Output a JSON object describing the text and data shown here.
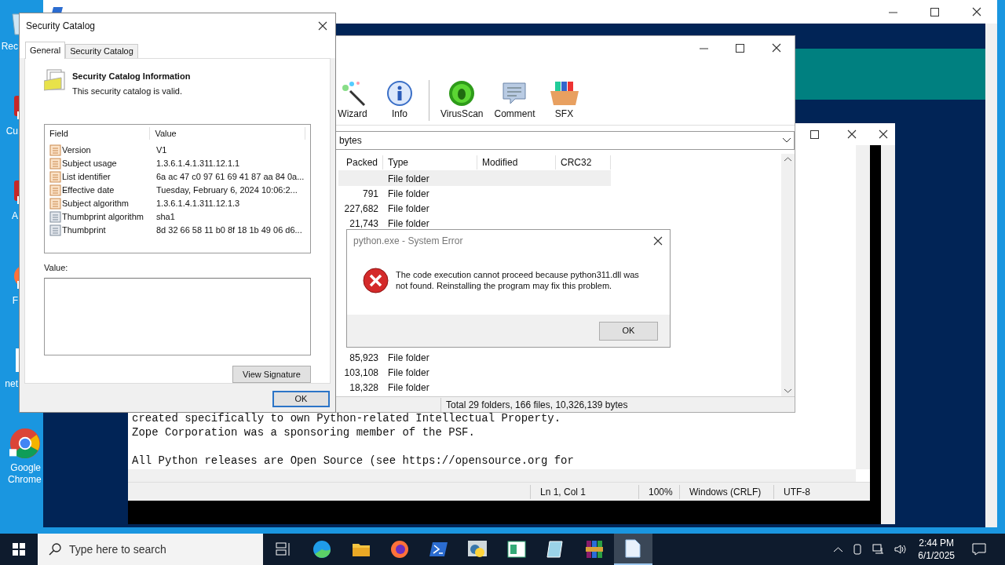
{
  "desktop_icons": [
    {
      "label": "Rec",
      "kind": "bin"
    },
    {
      "label": "Cu",
      "kind": "shortcut"
    },
    {
      "label": "A",
      "kind": "shortcut"
    },
    {
      "label": "F",
      "kind": "firefox"
    },
    {
      "label": "net",
      "kind": "file"
    },
    {
      "label": "Google Chrome",
      "kind": "chrome"
    }
  ],
  "notepad": {
    "paragraphs": [
      [
        "created specifically to own Python-related Intellectual Property.",
        "Zope Corporation was a sponsoring member of the PSF."
      ],
      [
        "All Python releases are Open Source (see https://opensource.org for"
      ]
    ],
    "status": [
      "Ln 1, Col 1",
      "100%",
      "Windows (CRLF)",
      "UTF-8"
    ]
  },
  "winrar": {
    "toolbar": [
      {
        "label": "Wizard",
        "kind": "wizard"
      },
      {
        "label": "Info",
        "kind": "info"
      },
      {
        "label": "VirusScan",
        "kind": "virus"
      },
      {
        "label": "Comment",
        "kind": "comment"
      },
      {
        "label": "SFX",
        "kind": "sfx"
      }
    ],
    "path": "bytes",
    "columns": [
      "Packed",
      "Type",
      "Modified",
      "CRC32"
    ],
    "rows_top": [
      {
        "type": "File folder",
        "selected": true
      },
      {
        "packed": "791",
        "type": "File folder",
        "selected": false
      },
      {
        "packed": "227,682",
        "type": "File folder",
        "selected": false
      },
      {
        "packed": "21,743",
        "type": "File folder",
        "selected": false
      }
    ],
    "rows_bottom": [
      {
        "packed": "85,923",
        "type": "File folder",
        "selected": false
      },
      {
        "packed": "103,108",
        "type": "File folder",
        "selected": false
      },
      {
        "packed": "18,328",
        "type": "File folder",
        "selected": false
      }
    ],
    "status": "Total 29 folders, 166 files, 10,326,139 bytes"
  },
  "security_catalog": {
    "title": "Security Catalog",
    "tabs": [
      {
        "label": "General",
        "selected": true
      },
      {
        "label": "Security Catalog",
        "selected": false
      }
    ],
    "heading": "Security Catalog Information",
    "subtitle": "This security catalog is valid.",
    "columns": [
      "Field",
      "Value"
    ],
    "rows": [
      {
        "field": "Version",
        "value": "V1",
        "kind": "attribute"
      },
      {
        "field": "Subject usage",
        "value": "1.3.6.1.4.1.311.12.1.1",
        "kind": "attribute"
      },
      {
        "field": "List identifier",
        "value": "6a ac 47 c0 97 61 69 41 87 aa 84 0a...",
        "kind": "attribute"
      },
      {
        "field": "Effective date",
        "value": "Tuesday, February 6, 2024 10:06:2...",
        "kind": "attribute"
      },
      {
        "field": "Subject algorithm",
        "value": "1.3.6.1.4.1.311.12.1.3",
        "kind": "attribute"
      },
      {
        "field": "Thumbprint algorithm",
        "value": "sha1",
        "kind": "property"
      },
      {
        "field": "Thumbprint",
        "value": "8d 32 66 58 11 b0 8f 18 1b 49 06 d6...",
        "kind": "property"
      }
    ],
    "value_label": "Value:",
    "view_button": "View Signature",
    "ok_button": "OK"
  },
  "error_dialog": {
    "title": "python.exe - System Error",
    "message": "The code execution cannot proceed because python311.dll was not found. Reinstalling the program may fix this problem.",
    "ok_button": "OK"
  },
  "taskbar": {
    "search_placeholder": "Type here to search",
    "apps": [
      {
        "kind": "taskview",
        "selected": false
      },
      {
        "kind": "edge",
        "selected": false
      },
      {
        "kind": "explorer",
        "selected": false
      },
      {
        "kind": "firefox",
        "selected": false
      },
      {
        "kind": "powershell",
        "selected": false
      },
      {
        "kind": "python",
        "selected": false
      },
      {
        "kind": "window",
        "selected": false
      },
      {
        "kind": "notebook",
        "selected": false
      },
      {
        "kind": "winrar",
        "selected": false
      },
      {
        "kind": "notepad",
        "selected": true
      }
    ],
    "time": "2:44 PM",
    "date": "6/1/2025"
  }
}
